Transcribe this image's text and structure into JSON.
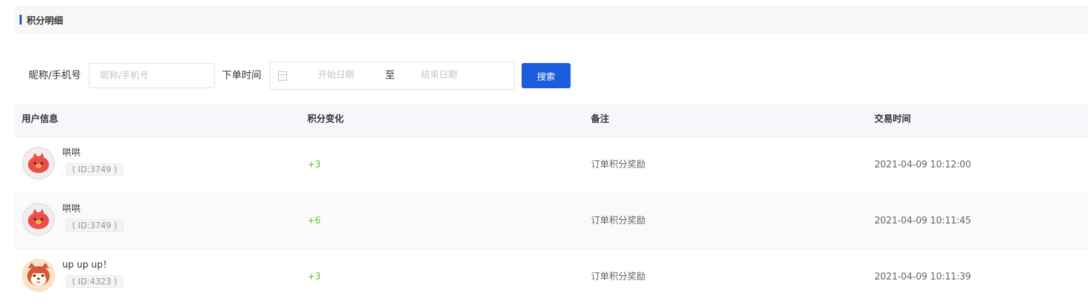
{
  "section": {
    "title": "积分明细"
  },
  "filters": {
    "nickname_label": "昵称/手机号",
    "nickname_placeholder": "昵称/手机号",
    "nickname_value": "",
    "time_label": "下单时间",
    "start_placeholder": "开始日期",
    "separator": "至",
    "end_placeholder": "结束日期",
    "search_label": "搜索"
  },
  "table": {
    "headers": [
      "用户信息",
      "积分变化",
      "备注",
      "交易时间"
    ],
    "rows": [
      {
        "name": "哄哄",
        "id": "( ID:3749 )",
        "points": "+3",
        "note": "订单积分奖励",
        "time": "2021-04-09 10:12:00",
        "avatar": "red-bird-avatar"
      },
      {
        "name": "哄哄",
        "id": "( ID:3749 )",
        "points": "+6",
        "note": "订单积分奖励",
        "time": "2021-04-09 10:11:45",
        "avatar": "red-bird-avatar"
      },
      {
        "name": "up up up！",
        "id": "( ID:4323 )",
        "points": "+3",
        "note": "订单积分奖励",
        "time": "2021-04-09 10:11:39",
        "avatar": "red-panda-avatar"
      }
    ]
  },
  "colors": {
    "accent": "#1a5cdb",
    "points_positive": "#67c23a",
    "header_bg": "#f7f7f7",
    "table_header_bg": "#f5f7fa"
  }
}
